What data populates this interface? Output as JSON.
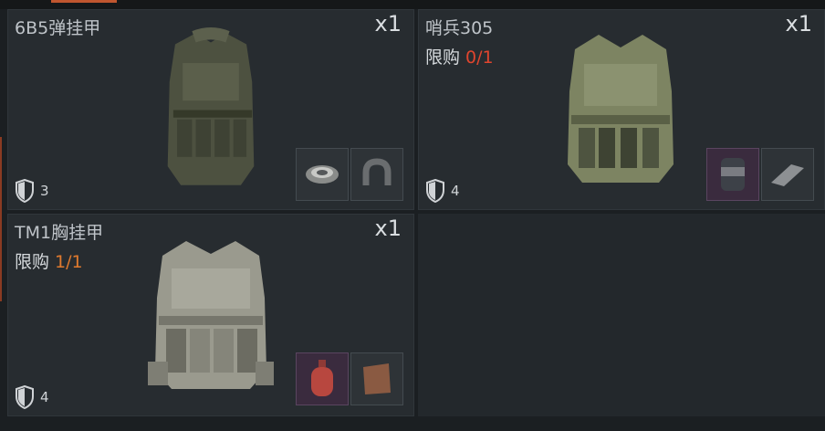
{
  "items": [
    {
      "name": "6B5弹挂甲",
      "quantity": "x1",
      "limit_label": "",
      "limit_value": "",
      "armor_level": "3",
      "icon": "vest-icon",
      "materials": [
        "grenade-ring-icon",
        "horseshoe-magnet-icon"
      ]
    },
    {
      "name": "哨兵305",
      "quantity": "x1",
      "limit_label": "限购",
      "limit_value": "0/1",
      "armor_level": "4",
      "icon": "vest-icon",
      "materials": [
        "canister-icon",
        "plate-icon"
      ]
    },
    {
      "name": "TM1胸挂甲",
      "quantity": "x1",
      "limit_label": "限购",
      "limit_value": "1/1",
      "armor_level": "4",
      "icon": "vest-icon",
      "materials": [
        "gas-cylinder-icon",
        "folder-icon"
      ]
    }
  ],
  "colors": {
    "accent": "#c0562f",
    "limit_exhausted": "#e0452e",
    "limit_available": "#e07a2e",
    "card_bg": "#272c30",
    "rare_slot": "#3a2b3e"
  }
}
